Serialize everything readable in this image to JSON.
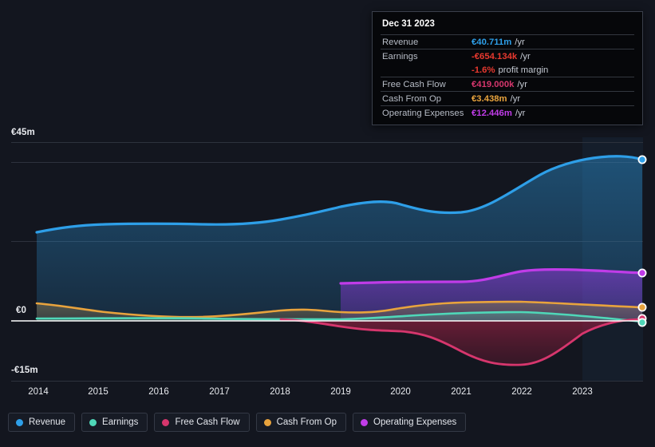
{
  "tooltip": {
    "title": "Dec 31 2023",
    "rows": [
      {
        "label": "Revenue",
        "value": "€40.711m",
        "unit": "/yr",
        "color": "#2e9fe8"
      },
      {
        "label": "Earnings",
        "value": "-€654.134k",
        "unit": "/yr",
        "color": "#e8392f"
      },
      {
        "label": "",
        "value": "-1.6%",
        "unit": "profit margin",
        "color": "#e8392f",
        "sub": true
      },
      {
        "label": "Free Cash Flow",
        "value": "€419.000k",
        "unit": "/yr",
        "color": "#d6366d"
      },
      {
        "label": "Cash From Op",
        "value": "€3.438m",
        "unit": "/yr",
        "color": "#e8a33d"
      },
      {
        "label": "Operating Expenses",
        "value": "€12.446m",
        "unit": "/yr",
        "color": "#c03ce8"
      }
    ]
  },
  "legend": [
    {
      "label": "Revenue",
      "color": "#2e9fe8"
    },
    {
      "label": "Earnings",
      "color": "#4fd7b8"
    },
    {
      "label": "Free Cash Flow",
      "color": "#d6366d"
    },
    {
      "label": "Cash From Op",
      "color": "#e8a33d"
    },
    {
      "label": "Operating Expenses",
      "color": "#c03ce8"
    }
  ],
  "axis": {
    "y_ticks": [
      {
        "label": "€45m",
        "value": 45
      },
      {
        "label": "€0",
        "value": 0
      },
      {
        "label": "-€15m",
        "value": -15
      }
    ],
    "x_ticks": [
      "2014",
      "2015",
      "2016",
      "2017",
      "2018",
      "2019",
      "2020",
      "2021",
      "2022",
      "2023"
    ]
  },
  "chart_data": {
    "type": "area",
    "title": "",
    "xlabel": "",
    "ylabel": "",
    "currency": "EUR",
    "ylim": [
      -15,
      45
    ],
    "grid": true,
    "legend_position": "bottom",
    "x": [
      2014,
      2015,
      2016,
      2017,
      2018,
      2019,
      2020,
      2021,
      2022,
      2023
    ],
    "series": [
      {
        "name": "Revenue",
        "color": "#2e9fe8",
        "values": [
          22.2,
          23.4,
          23.6,
          23.6,
          24.6,
          26.2,
          27.4,
          27.0,
          31.6,
          40.711
        ]
      },
      {
        "name": "Earnings",
        "color": "#4fd7b8",
        "values": [
          0.6,
          0.6,
          0.7,
          0.6,
          0.5,
          0.4,
          1.0,
          1.6,
          1.8,
          -0.654
        ]
      },
      {
        "name": "Free Cash Flow",
        "color": "#d6366d",
        "values": [
          null,
          null,
          null,
          null,
          0.3,
          -0.2,
          -1.9,
          -2.8,
          -10.6,
          0.419
        ]
      },
      {
        "name": "Cash From Op",
        "color": "#e8a33d",
        "values": [
          4.4,
          3.6,
          2.2,
          1.0,
          1.6,
          2.3,
          2.3,
          3.4,
          4.8,
          3.438
        ]
      },
      {
        "name": "Operating Expenses",
        "color": "#c03ce8",
        "values": [
          null,
          null,
          null,
          null,
          null,
          9.4,
          9.5,
          9.6,
          12.6,
          12.446
        ]
      }
    ],
    "endpoint_markers": [
      "Revenue",
      "Earnings",
      "Free Cash Flow",
      "Cash From Op",
      "Operating Expenses"
    ]
  }
}
